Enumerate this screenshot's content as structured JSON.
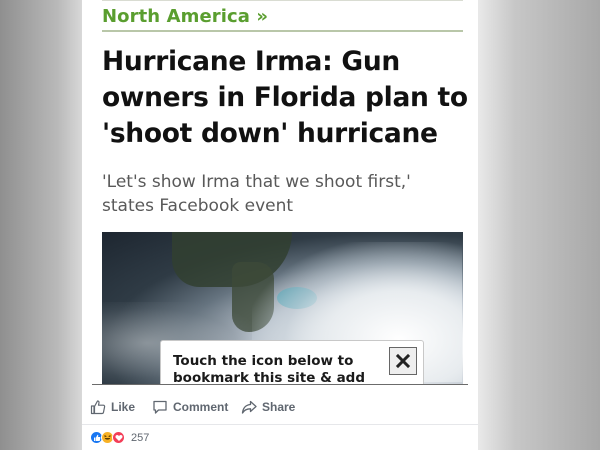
{
  "article": {
    "section_label": "North America »",
    "headline": "Hurricane Irma: Gun owners in Florida plan to 'shoot down' hurricane",
    "subheadline": "'Let's show Irma that we shoot first,' states Facebook event",
    "image_icon": "satellite-image"
  },
  "popup": {
    "text": "Touch the icon below to bookmark this site & add an",
    "close_icon": "close-icon"
  },
  "actions": {
    "like_label": "Like",
    "comment_label": "Comment",
    "share_label": "Share"
  },
  "reactions": {
    "icons": [
      "like-reaction-icon",
      "haha-reaction-icon",
      "love-reaction-icon"
    ],
    "count": "257"
  },
  "colors": {
    "section_green": "#5a9e2f",
    "action_gray": "#606770",
    "like_blue": "#1877f2",
    "love_red": "#f33e58",
    "haha_yellow": "#f7b125"
  }
}
